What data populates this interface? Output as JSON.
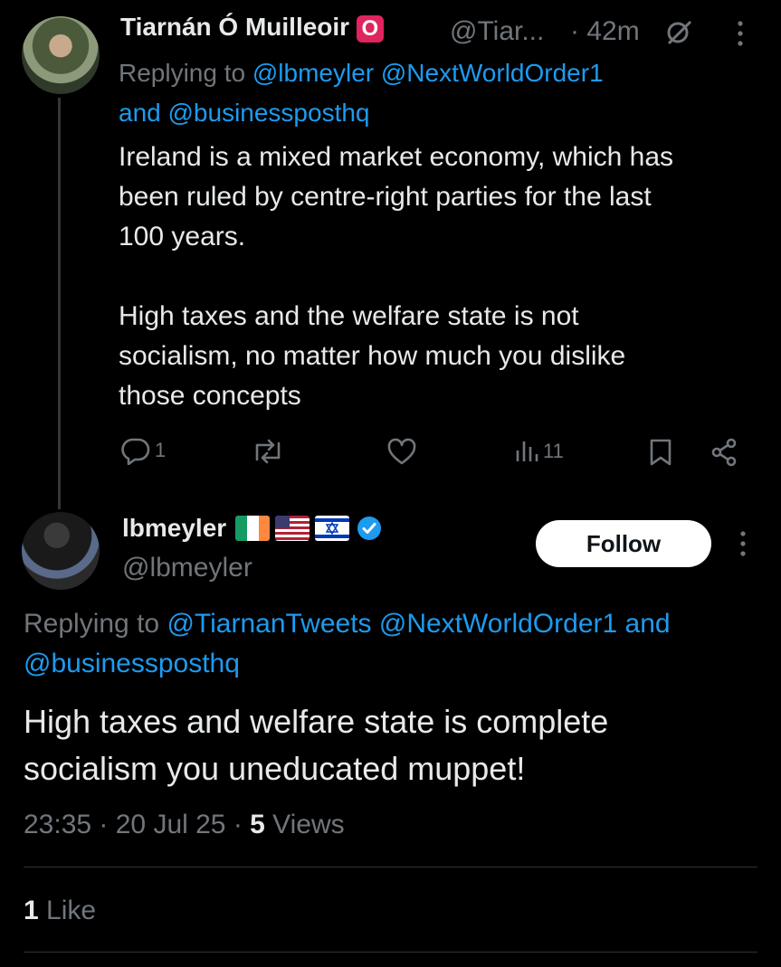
{
  "reply": {
    "display_name": "Tiarnán Ó Muilleoir",
    "badge": "O",
    "handle": "@Tiar...",
    "time": "· 42m",
    "replying_prefix": "Replying to",
    "replying_mentions_line1": "@lbmeyler @NextWorldOrder1",
    "replying_and": "and",
    "replying_mentions_line2": "@businessposthq",
    "body": [
      "Ireland is a mixed market economy, which has",
      "been ruled by centre-right parties for the last",
      "100 years.",
      "",
      "High taxes and the welfare state is not",
      "socialism, no matter how much you dislike",
      "those concepts"
    ],
    "actions": {
      "reply_count": "1",
      "repost_count": "",
      "like_count": "",
      "views_count": "11"
    }
  },
  "main": {
    "display_name": "lbmeyler",
    "handle": "@lbmeyler",
    "follow_label": "Follow",
    "replying_prefix": "Replying to",
    "replying_line1_mentions": "@TiarnanTweets @NextWorldOrder1",
    "replying_and": "and",
    "replying_line2_mentions": "@businessposthq",
    "body": [
      "High taxes and welfare state is complete",
      "socialism you uneducated muppet!"
    ],
    "meta_time": "23:35 · 20 Jul 25 · ",
    "meta_views_count": "5",
    "meta_views_label": " Views",
    "likes_count": "1",
    "likes_label": " Like"
  },
  "colors": {
    "background": "#000000",
    "text": "#e7e9ea",
    "muted": "#71767b",
    "link": "#1d9bf0",
    "verified": "#1d9bf0",
    "badge": "#e0245e"
  },
  "icons": [
    "more-icon",
    "mute-icon",
    "reply-icon",
    "repost-icon",
    "like-icon",
    "views-icon",
    "bookmark-icon",
    "share-icon",
    "verified-icon"
  ]
}
